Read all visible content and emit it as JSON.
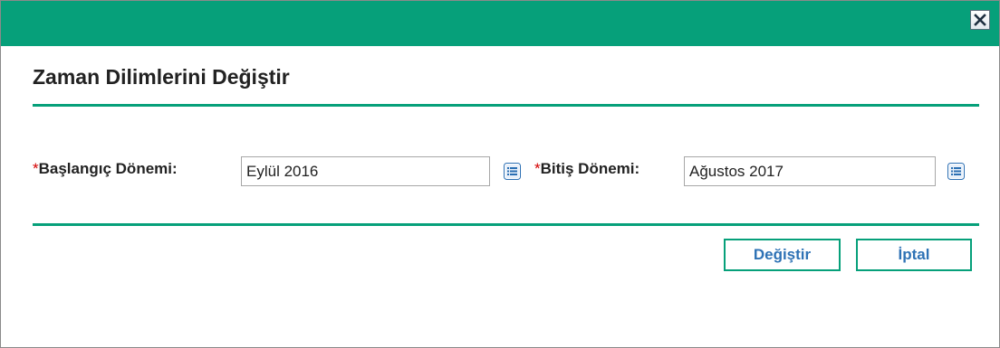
{
  "dialog": {
    "title": "Zaman Dilimlerini Değiştir",
    "close_icon": "close-icon",
    "accent_color": "#06a07a"
  },
  "form": {
    "required_marker": "*",
    "start": {
      "label": "Başlangıç Dönemi:",
      "value": "Eylül 2016",
      "picker_icon": "list-picker-icon"
    },
    "end": {
      "label": "Bitiş Dönemi:",
      "value": "Ağustos 2017",
      "picker_icon": "list-picker-icon"
    }
  },
  "actions": {
    "apply_label": "Değiştir",
    "cancel_label": "İptal"
  }
}
